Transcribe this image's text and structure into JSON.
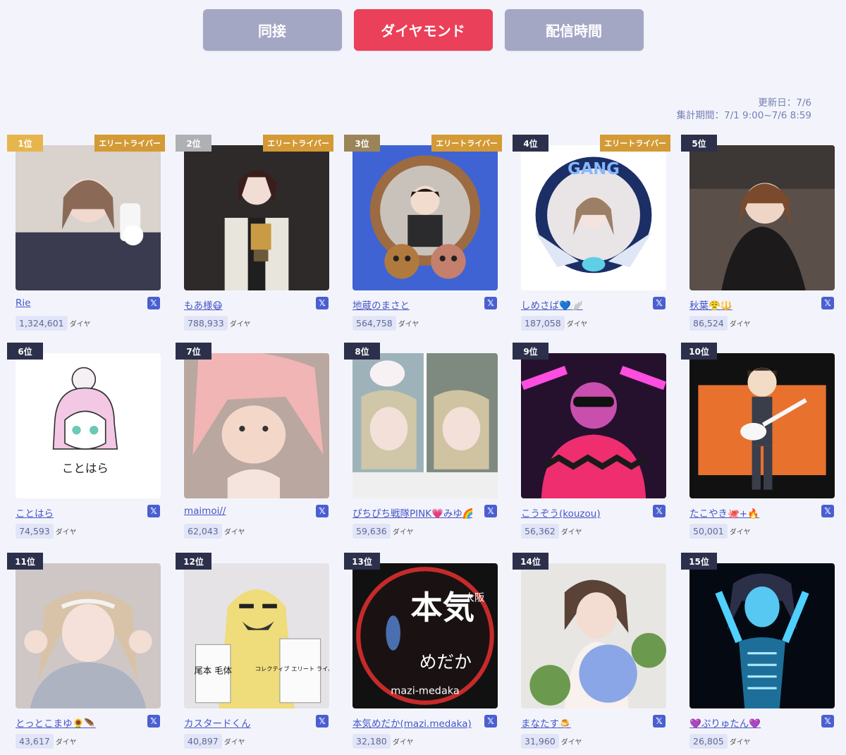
{
  "tabs": [
    {
      "label": "同接",
      "active": false
    },
    {
      "label": "ダイヤモンド",
      "active": true
    },
    {
      "label": "配信時間",
      "active": false
    }
  ],
  "meta": {
    "updated": "更新日：7/6",
    "period": "集計期間：7/1 9:00~7/6 8:59"
  },
  "colors": {
    "accent": "#eb4059",
    "tab_inactive": "#a3a7c4",
    "link": "#4456c8",
    "gold": "#e7b54d",
    "silver": "#aeb0b3",
    "bronze": "#9a8458",
    "elite_badge": "#d39a35",
    "rank_dark": "#2c304b"
  },
  "unit_label": "ダイヤ",
  "x_icon": "x-logo-icon",
  "rankings": [
    {
      "rank": "1位",
      "elite": "エリートライバー",
      "name": "Rie",
      "diamonds": "1,324,601",
      "photo": "woman-selfie"
    },
    {
      "rank": "2位",
      "elite": "エリートライバー",
      "name": "もあ様😷",
      "diamonds": "788,933",
      "photo": "man-kimono-trophy"
    },
    {
      "rank": "3位",
      "elite": "エリートライバー",
      "name": "地蔵のまさと",
      "diamonds": "564,758",
      "photo": "ornate-frame-chipmunks"
    },
    {
      "rank": "4位",
      "elite": "エリートライバー",
      "name": "しめさば💙🪽",
      "diamonds": "187,058",
      "photo": "gang-wings-emblem"
    },
    {
      "rank": "5位",
      "elite": "",
      "name": "秋葉😤🔱",
      "diamonds": "86,524",
      "photo": "woman-black-top"
    },
    {
      "rank": "6位",
      "elite": "",
      "name": "ことはら",
      "diamonds": "74,593",
      "photo": "illustration-girl-kotohara"
    },
    {
      "rank": "7位",
      "elite": "",
      "name": "maimoi//",
      "diamonds": "62,043",
      "photo": "woman-pink-hair"
    },
    {
      "rank": "8位",
      "elite": "",
      "name": "ぴちぴち戦隊PINK💗みゆ🌈",
      "diamonds": "59,636",
      "photo": "split-selfie-melody"
    },
    {
      "rank": "9位",
      "elite": "",
      "name": "こうぞう(kouzou)",
      "diamonds": "56,362",
      "photo": "man-sunglasses-neon"
    },
    {
      "rank": "10位",
      "elite": "",
      "name": "たこやき🐙+🔥",
      "diamonds": "50,001",
      "photo": "illustration-guitarist"
    },
    {
      "rank": "11位",
      "elite": "",
      "name": "とっとこまゆ🌻🪶",
      "diamonds": "43,617",
      "photo": "woman-smile-headband"
    },
    {
      "rank": "12位",
      "elite": "",
      "name": "カスタードくん",
      "diamonds": "40,897",
      "photo": "yellow-plush-sign"
    },
    {
      "rank": "13位",
      "elite": "",
      "name": "本気めだか(mazi.medaka)",
      "diamonds": "32,180",
      "photo": "medaka-logo"
    },
    {
      "rank": "14位",
      "elite": "",
      "name": "まなたす🍮",
      "diamonds": "31,960",
      "photo": "woman-hydrangea"
    },
    {
      "rank": "15位",
      "elite": "",
      "name": "💜ぷりゅたん💜",
      "diamonds": "26,805",
      "photo": "xray-glow-girl"
    }
  ],
  "photo_text": {
    "gang": "GANG",
    "kotohara": "ことはら",
    "honki": "本気",
    "medaka": "めだか",
    "osaka": "大阪",
    "mazi": "mazi-medaka",
    "sign_left": "尾本 毛体",
    "sign_right": "コレクティブ エリート ライバーだ"
  }
}
